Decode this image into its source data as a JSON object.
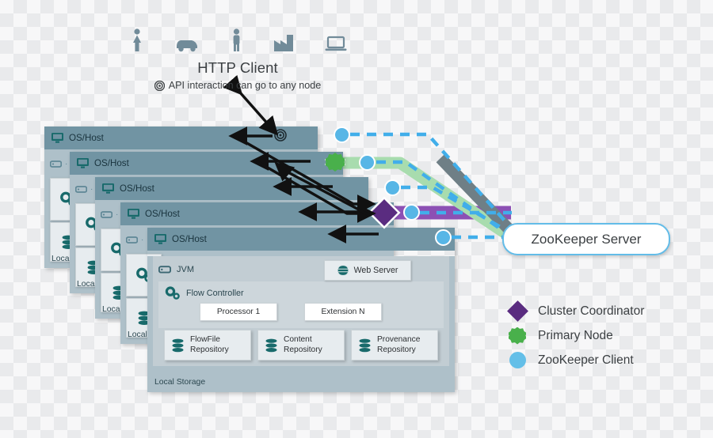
{
  "client": {
    "title": "HTTP Client",
    "subtitle": "API interaction can go to any node",
    "target_icon": "target-icon",
    "icons": [
      {
        "name": "person-woman-icon"
      },
      {
        "name": "car-icon"
      },
      {
        "name": "person-man-icon"
      },
      {
        "name": "factory-icon"
      },
      {
        "name": "laptop-icon"
      }
    ]
  },
  "node": {
    "os_host_label": "OS/Host",
    "jvm_label": "JVM",
    "web_server_label": "Web Server",
    "flow_controller_label": "Flow Controller",
    "processor_label": "Processor 1",
    "extension_label": "Extension N",
    "local_storage_label": "Local Storage",
    "local_short_label": "Local",
    "repositories": [
      {
        "line1": "FlowFile",
        "line2": "Repository"
      },
      {
        "line1": "Content",
        "line2": "Repository"
      },
      {
        "line1": "Provenance",
        "line2": "Repository"
      }
    ]
  },
  "zookeeper": {
    "server_label": "ZooKeeper Server"
  },
  "legend": {
    "items": [
      {
        "label": "Cluster Coordinator",
        "marker": "diamond",
        "color": "#5a2c80"
      },
      {
        "label": "Primary Node",
        "marker": "star",
        "color": "#49b04b"
      },
      {
        "label": "ZooKeeper Client",
        "marker": "circle",
        "color": "#64bfe8"
      }
    ]
  },
  "colors": {
    "node_header": "#7194a3",
    "node_body": "#aec0c9",
    "zk_client": "#57b6e6",
    "primary_node": "#49b04b",
    "cluster_coordinator": "#5a2c80",
    "icon_teal": "#186a6b",
    "client_icon": "#718b99"
  }
}
